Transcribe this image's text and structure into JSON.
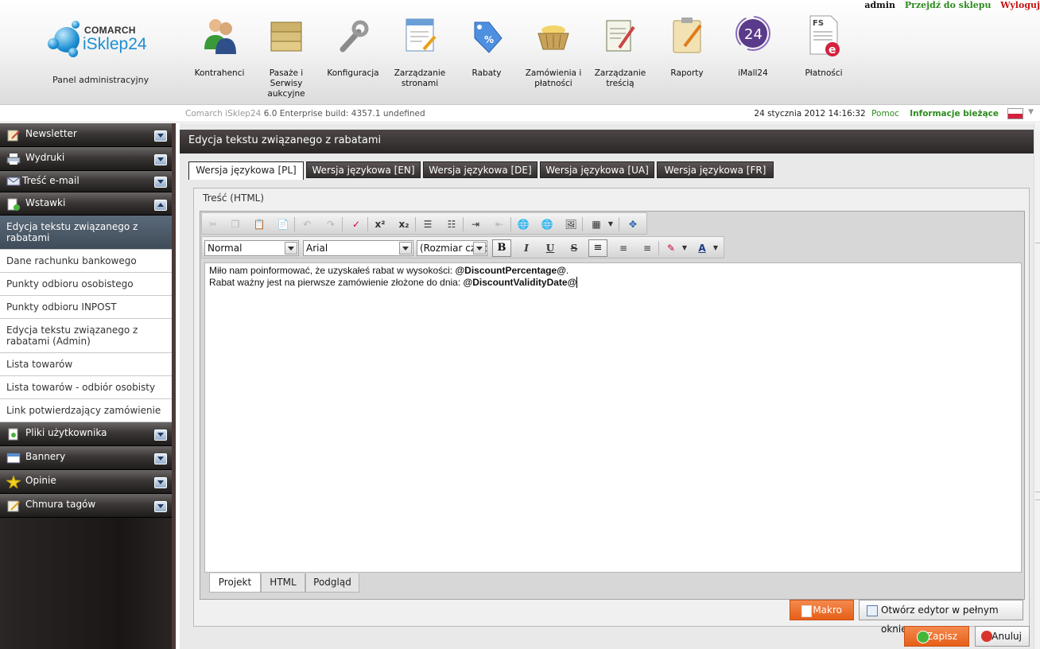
{
  "header": {
    "user": "admin",
    "shop_link": "Przejdź do sklepu",
    "logout_link": "Wyloguj",
    "logo_brand": "COMARCH",
    "logo_product": "iSklep24",
    "panel_label": "Panel administracyjny",
    "tools": [
      {
        "label": "Kontrahenci",
        "icon": "users-icon"
      },
      {
        "label": "Pasaże i Serwisy aukcyjne",
        "icon": "folders-icon"
      },
      {
        "label": "Konfiguracja",
        "icon": "wrench-icon"
      },
      {
        "label": "Zarządzanie stronami",
        "icon": "page-edit-icon"
      },
      {
        "label": "Rabaty",
        "icon": "discount-tag-icon"
      },
      {
        "label": "Zamówienia i płatności",
        "icon": "basket-icon"
      },
      {
        "label": "Zarządzanie treścią",
        "icon": "content-edit-icon"
      },
      {
        "label": "Raporty",
        "icon": "clipboard-icon"
      },
      {
        "label": "iMall24",
        "icon": "imall24-icon"
      },
      {
        "label": "Płatności",
        "icon": "payments-document-icon"
      }
    ],
    "imall_badge": "24",
    "fs_badge": "FS",
    "e_badge": "e"
  },
  "status": {
    "build_prefix": "Comarch iSklep24",
    "build_text": "6.0 Enterprise build: 4357.1  undefined",
    "datetime": "24 stycznia 2012 14:16:32",
    "help": "Pomoc",
    "news": "Informacje bieżące"
  },
  "sidebar": {
    "sections_top": [
      {
        "label": "Newsletter",
        "icon": "newsletter-icon",
        "expanded": false
      },
      {
        "label": "Wydruki",
        "icon": "printer-icon",
        "expanded": false
      },
      {
        "label": "Treść e-mail",
        "icon": "envelope-icon",
        "expanded": false
      },
      {
        "label": "Wstawki",
        "icon": "document-check-icon",
        "expanded": true
      }
    ],
    "items": [
      "Edycja tekstu związanego z rabatami",
      "Dane rachunku bankowego",
      "Punkty odbioru osobistego",
      "Punkty odbioru INPOST",
      "Edycja tekstu związanego z rabatami (Admin)",
      "Lista towarów",
      "Lista towarów - odbiór osobisty",
      "Link potwierdzający zamówienie"
    ],
    "active_item_index": 0,
    "sections_bottom": [
      {
        "label": "Pliki użytkownika",
        "icon": "user-files-icon",
        "expanded": false
      },
      {
        "label": "Bannery",
        "icon": "banner-icon",
        "expanded": false
      },
      {
        "label": "Opinie",
        "icon": "star-icon",
        "expanded": false
      },
      {
        "label": "Chmura tagów",
        "icon": "tag-cloud-icon",
        "expanded": false
      }
    ]
  },
  "main": {
    "title": "Edycja tekstu związanego z rabatami",
    "lang_tabs": [
      "Wersja językowa [PL]",
      "Wersja językowa [EN]",
      "Wersja językowa [DE]",
      "Wersja językowa [UA]",
      "Wersja językowa [FR]"
    ],
    "active_lang_tab": 0,
    "panel_label": "Treść (HTML)",
    "editor": {
      "format_select": "Normal",
      "font_select": "Arial",
      "size_select": "(Rozmiar czcionki)",
      "bold": "B",
      "italic": "I",
      "underline": "U",
      "strike": "S",
      "line1_text": "Miło nam poinformować, że uzyskałeś rabat w wysokości: ",
      "line1_macro": "@DiscountPercentage@",
      "line1_end": ".",
      "line2_text": "Rabat ważny jest na pierwsze zamówienie złożone do dnia: ",
      "line2_macro": "@DiscountValidityDate@",
      "modes": [
        "Projekt",
        "HTML",
        "Podgląd"
      ],
      "active_mode": 0
    },
    "makro_button": "Makro",
    "fullscreen_button": "Otwórz edytor w pełnym oknie",
    "save_button": "Zapisz",
    "cancel_button": "Anuluj"
  },
  "colors": {
    "accent_orange": "#e65f18",
    "link_green": "#2c8a1e",
    "logout_red": "#c81414",
    "sidebar_dark": "#1a1616"
  }
}
